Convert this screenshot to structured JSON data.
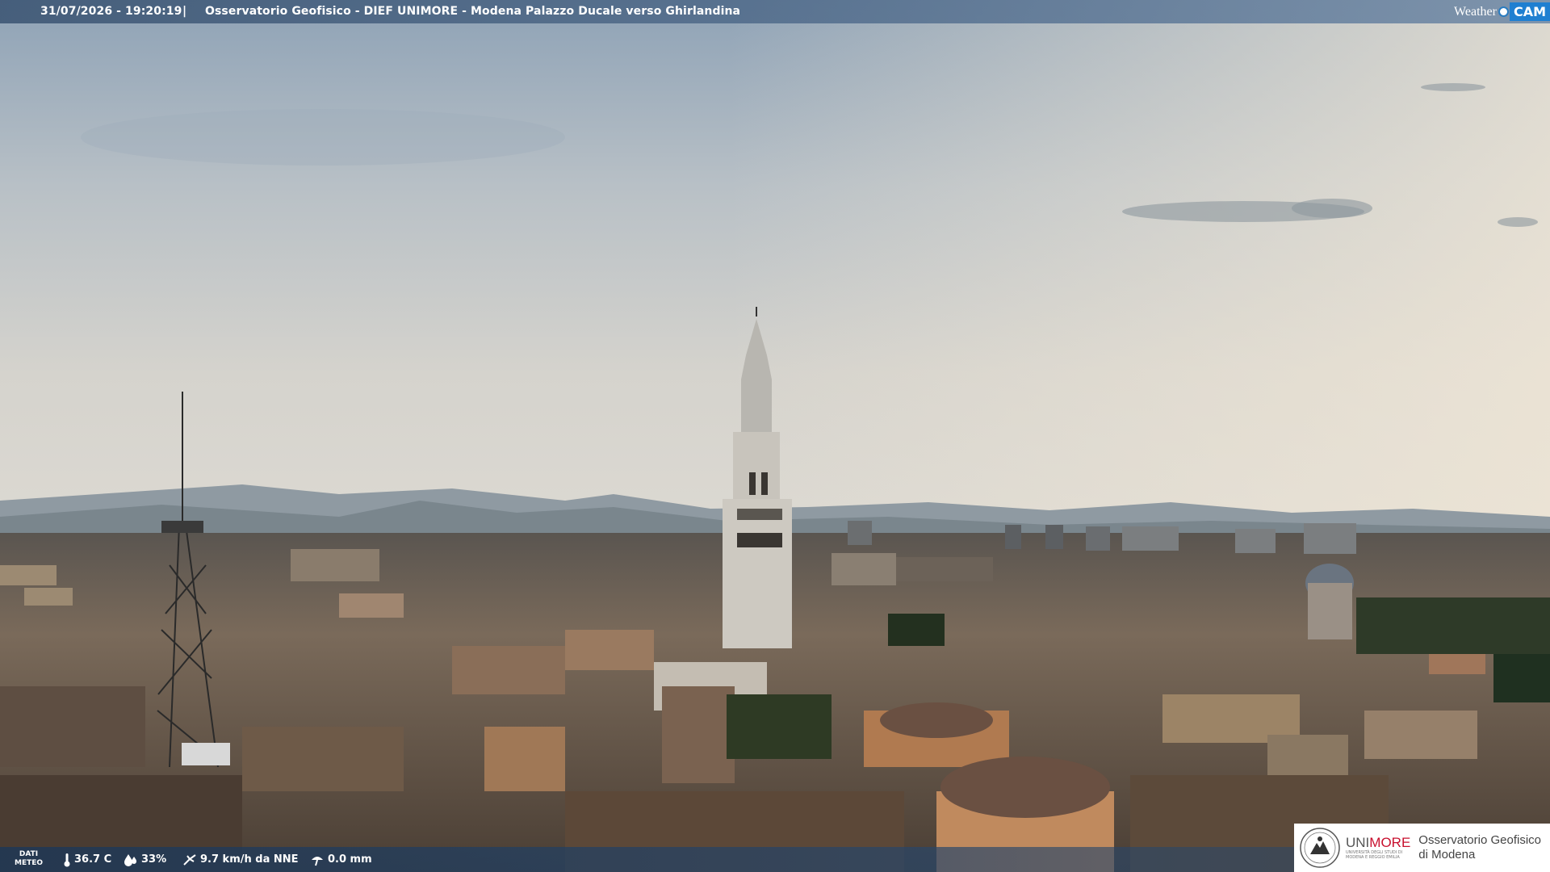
{
  "header": {
    "timestamp": "31/07/2026 - 19:20:19",
    "separator": "|",
    "title": "Osservatorio Geofisico - DIEF UNIMORE - Modena Palazzo Ducale verso Ghirlandina"
  },
  "brand": {
    "weather": "Weather",
    "cam": "CAM"
  },
  "weather_bar": {
    "label_line1": "DATI",
    "label_line2": "METEO",
    "temperature": "36.7 C",
    "humidity": "33%",
    "wind": "9.7 km/h da NNE",
    "rain": "0.0 mm",
    "icons": [
      "thermometer-icon",
      "humidity-drop-icon",
      "wind-icon",
      "rain-gauge-icon"
    ]
  },
  "logo": {
    "uni_prefix": "UNI",
    "uni_suffix": "MORE",
    "uni_sub": "UNIVERSITÀ DEGLI STUDI DI MODENA E REGGIO EMILIA",
    "observatory_line1": "Osservatorio Geofisico",
    "observatory_line2": "di Modena"
  },
  "colors": {
    "accent": "#1f7fd1",
    "unimore_red": "#c8102e",
    "sky_top": "#8fa3b8",
    "sky_horizon": "#d9d6cf",
    "roofs": "#6a5a4c"
  }
}
